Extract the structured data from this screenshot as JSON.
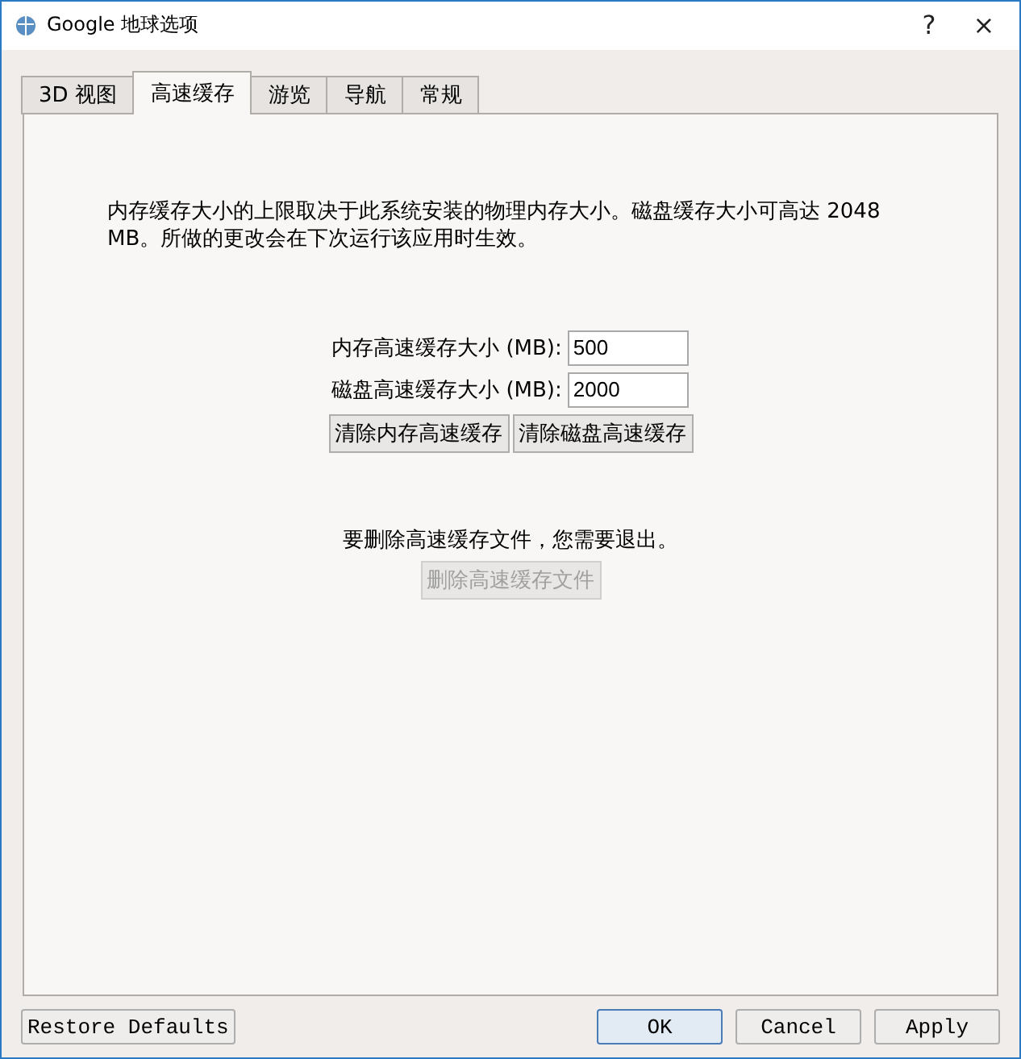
{
  "window": {
    "title": "Google 地球选项",
    "help": "?",
    "close": "×"
  },
  "tabs": [
    {
      "label": "3D 视图",
      "selected": false
    },
    {
      "label": "高速缓存",
      "selected": true
    },
    {
      "label": "游览",
      "selected": false
    },
    {
      "label": "导航",
      "selected": false
    },
    {
      "label": "常规",
      "selected": false
    }
  ],
  "description": "内存缓存大小的上限取决于此系统安装的物理内存大小。磁盘缓存大小可高达 2048 MB。所做的更改会在下次运行该应用时生效。",
  "fields": [
    {
      "label": "内存高速缓存大小 (MB):",
      "value": "500"
    },
    {
      "label": "磁盘高速缓存大小 (MB):",
      "value": "2000"
    }
  ],
  "clear_buttons": [
    {
      "label": "清除内存高速缓存",
      "disabled": false
    },
    {
      "label": "清除磁盘高速缓存",
      "disabled": false
    }
  ],
  "note": "要删除高速缓存文件，您需要退出。",
  "delete_button": {
    "label": "删除高速缓存文件",
    "disabled": true
  },
  "footer": {
    "restore": "Restore Defaults",
    "buttons": [
      {
        "label": "OK",
        "default": true
      },
      {
        "label": "Cancel",
        "default": false
      },
      {
        "label": "Apply",
        "default": false
      }
    ]
  }
}
